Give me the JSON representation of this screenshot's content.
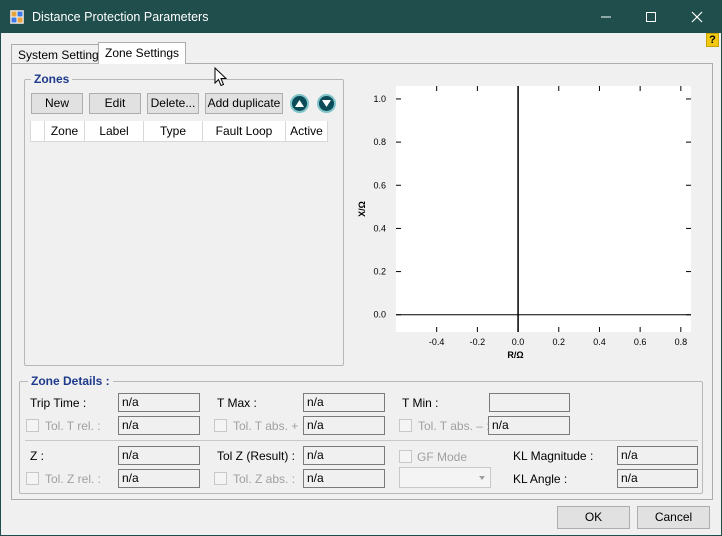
{
  "window": {
    "title": "Distance Protection Parameters",
    "controls": {
      "minimize": "—",
      "maximize": "☐",
      "close": "✕"
    },
    "help": "?"
  },
  "tabs": [
    {
      "label": "System Settings",
      "active": false
    },
    {
      "label": "Zone Settings",
      "active": true
    }
  ],
  "zones": {
    "legend": "Zones",
    "buttons": {
      "new": "New",
      "edit": "Edit",
      "delete": "Delete...",
      "add_duplicate": "Add duplicate"
    },
    "columns": [
      "Zone",
      "Label",
      "Type",
      "Fault Loop",
      "Active"
    ]
  },
  "chart_data": {
    "type": "scatter",
    "xlabel": "R/Ω",
    "ylabel": "X/Ω",
    "xlim": [
      -0.6,
      0.85
    ],
    "ylim": [
      -0.08,
      1.06
    ],
    "xticks": [
      "-0.4",
      "-0.2",
      "0.0",
      "0.2",
      "0.4",
      "0.6",
      "0.8"
    ],
    "xtick_values": [
      -0.4,
      -0.2,
      0.0,
      0.2,
      0.4,
      0.6,
      0.8
    ],
    "yticks": [
      "0.0",
      "0.2",
      "0.4",
      "0.6",
      "0.8",
      "1.0"
    ],
    "ytick_values": [
      0.0,
      0.2,
      0.4,
      0.6,
      0.8,
      1.0
    ],
    "series": [],
    "grid": false
  },
  "zone_details": {
    "legend": "Zone Details :",
    "trip_time": {
      "label": "Trip Time :",
      "value": "n/a"
    },
    "tol_t_rel": {
      "label": "Tol. T rel. :",
      "value": "n/a"
    },
    "t_max": {
      "label": "T Max :",
      "value": "n/a"
    },
    "tol_t_abs_plus": {
      "label": "Tol. T abs. + :",
      "value": "n/a"
    },
    "t_min": {
      "label": "T Min :",
      "value": ""
    },
    "tol_t_abs_minus": {
      "label": "Tol. T abs. – :",
      "value": "n/a"
    },
    "z": {
      "label": "Z :",
      "value": "n/a"
    },
    "tol_z_rel": {
      "label": "Tol. Z rel. :",
      "value": "n/a"
    },
    "tol_z_result": {
      "label": "Tol Z (Result) :",
      "value": "n/a"
    },
    "tol_z_abs": {
      "label": "Tol. Z abs. :",
      "value": "n/a"
    },
    "gf_mode": {
      "label": "GF Mode",
      "value": ""
    },
    "kl_magnitude": {
      "label": "KL Magnitude :",
      "value": "n/a"
    },
    "kl_angle": {
      "label": "KL Angle :",
      "value": "n/a"
    }
  },
  "footer": {
    "ok": "OK",
    "cancel": "Cancel"
  }
}
